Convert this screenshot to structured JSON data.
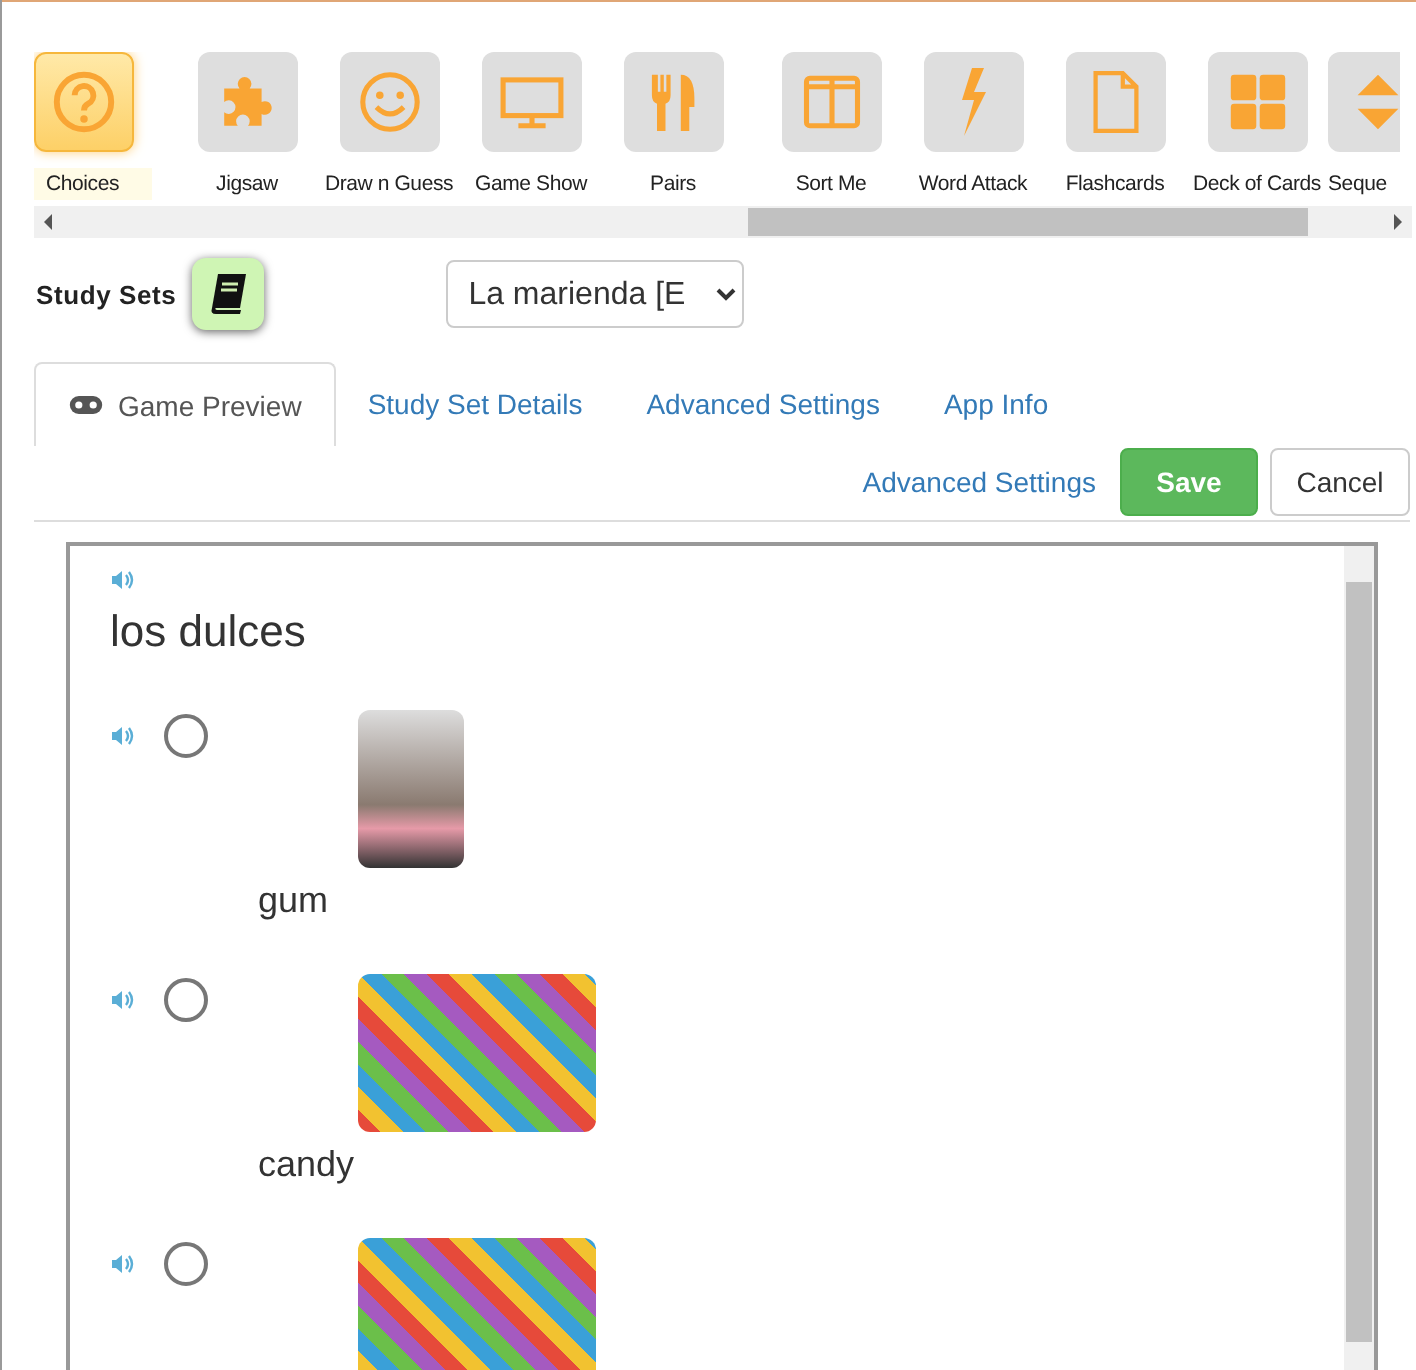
{
  "games": [
    {
      "label": "Choices",
      "selected": true
    },
    {
      "label": "Jigsaw",
      "selected": false
    },
    {
      "label": "Draw n Guess",
      "selected": false
    },
    {
      "label": "Game Show",
      "selected": false
    },
    {
      "label": "Pairs",
      "selected": false
    },
    {
      "label": "Sort Me",
      "selected": false
    },
    {
      "label": "Word Attack",
      "selected": false
    },
    {
      "label": "Flashcards",
      "selected": false
    },
    {
      "label": "Deck of Cards",
      "selected": false
    },
    {
      "label": "Seque",
      "selected": false
    }
  ],
  "study_sets": {
    "label": "Study Sets",
    "select_value": "La marienda [E"
  },
  "tabs": [
    {
      "label": "Game Preview",
      "selected": true
    },
    {
      "label": "Study Set Details",
      "selected": false
    },
    {
      "label": "Advanced Settings",
      "selected": false
    },
    {
      "label": "App Info",
      "selected": false
    }
  ],
  "actions": {
    "link": "Advanced Settings",
    "save": "Save",
    "cancel": "Cancel"
  },
  "question": {
    "prompt": "los dulces",
    "options": [
      {
        "label": "gum",
        "selected": false
      },
      {
        "label": "candy",
        "selected": false
      },
      {
        "selected": false
      }
    ]
  }
}
